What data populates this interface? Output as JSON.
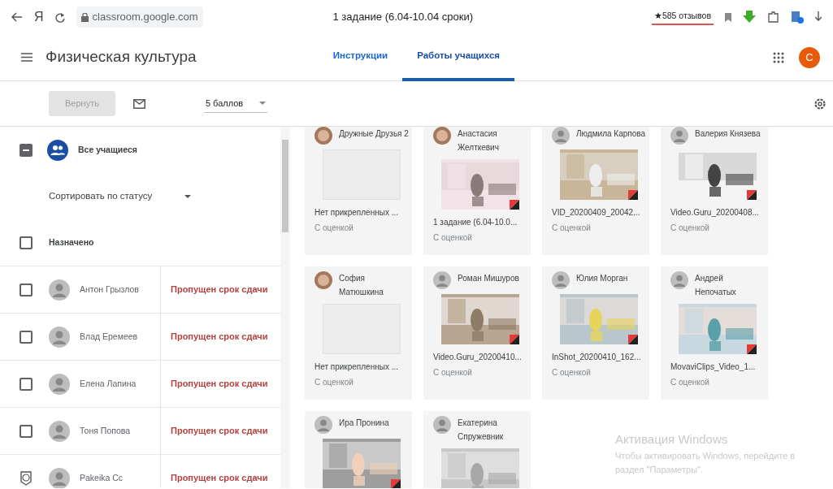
{
  "browser": {
    "logo_letter": "Я",
    "url": "classroom.google.com",
    "page_title": "1 задание (6.04-10.04 сроки)",
    "reviews": "★585 отзывов"
  },
  "header": {
    "course": "Физическая культура",
    "avatar_letter": "C",
    "tabs": [
      {
        "label": "Инструкции",
        "selected": false
      },
      {
        "label": "Работы учащихся",
        "selected": true
      }
    ]
  },
  "toolbar": {
    "return_button": {
      "label": "Вернуть",
      "disabled": true
    },
    "points": "5 баллов"
  },
  "roster": {
    "all_students": {
      "label": "Все учащиеся",
      "indeterminate": true
    },
    "sort": "Сортировать по статусу",
    "group": {
      "label": "Назначено",
      "checked": false
    },
    "students": [
      {
        "kind": "checkbox",
        "checked": false,
        "name": "Антон Грызлов",
        "status": "Пропущен срок сдачи"
      },
      {
        "kind": "checkbox",
        "checked": false,
        "name": "Влад Еремеев",
        "status": "Пропущен срок сдачи"
      },
      {
        "kind": "checkbox",
        "checked": false,
        "name": "Елена Лапина",
        "status": "Пропущен срок сдачи"
      },
      {
        "kind": "checkbox",
        "checked": false,
        "name": "Тоня Попова",
        "status": "Пропущен срок сдачи"
      },
      {
        "kind": "help",
        "name": "Pakeika Cc",
        "status": "Пропущен срок сдачи"
      }
    ]
  },
  "submissions": [
    {
      "photo_avatar": true,
      "name": "Дружные Друзья 2",
      "attachment": false,
      "file": "Нет прикрепленных ...",
      "status": "С оценкой"
    },
    {
      "photo_avatar": true,
      "name": "Анастасия Желткевич",
      "attachment": true,
      "file": "1 задание (6.04-10.0...",
      "status": "С оценкой"
    },
    {
      "photo_avatar": false,
      "name": "Людмила Карпова",
      "attachment": true,
      "file": "VID_20200409_20042...",
      "status": "С оценкой"
    },
    {
      "photo_avatar": false,
      "name": "Валерия Князева",
      "attachment": true,
      "file": "Video.Guru_20200408...",
      "status": "С оценкой"
    },
    {
      "photo_avatar": true,
      "name": "София Матюшкина",
      "attachment": false,
      "file": "Нет прикрепленных ...",
      "status": "С оценкой"
    },
    {
      "photo_avatar": false,
      "name": "Роман Мишуров",
      "attachment": true,
      "file": "Video.Guru_20200410...",
      "status": "С оценкой"
    },
    {
      "photo_avatar": false,
      "name": "Юлия Морган",
      "attachment": true,
      "file": "InShot_20200410_162...",
      "status": "С оценкой"
    },
    {
      "photo_avatar": false,
      "name": "Андрей Непочатых",
      "attachment": true,
      "file": "MovaviClips_Video_1...",
      "status": "С оценкой"
    },
    {
      "photo_avatar": false,
      "name": "Ира Пронина",
      "attachment": true
    },
    {
      "photo_avatar": false,
      "name": "Екатерина Спружевник",
      "attachment": true
    }
  ],
  "os_notice": {
    "title": "Активация Windows",
    "text": "Чтобы активировать Windows, перейдите в раздел \"Параметры\"."
  }
}
